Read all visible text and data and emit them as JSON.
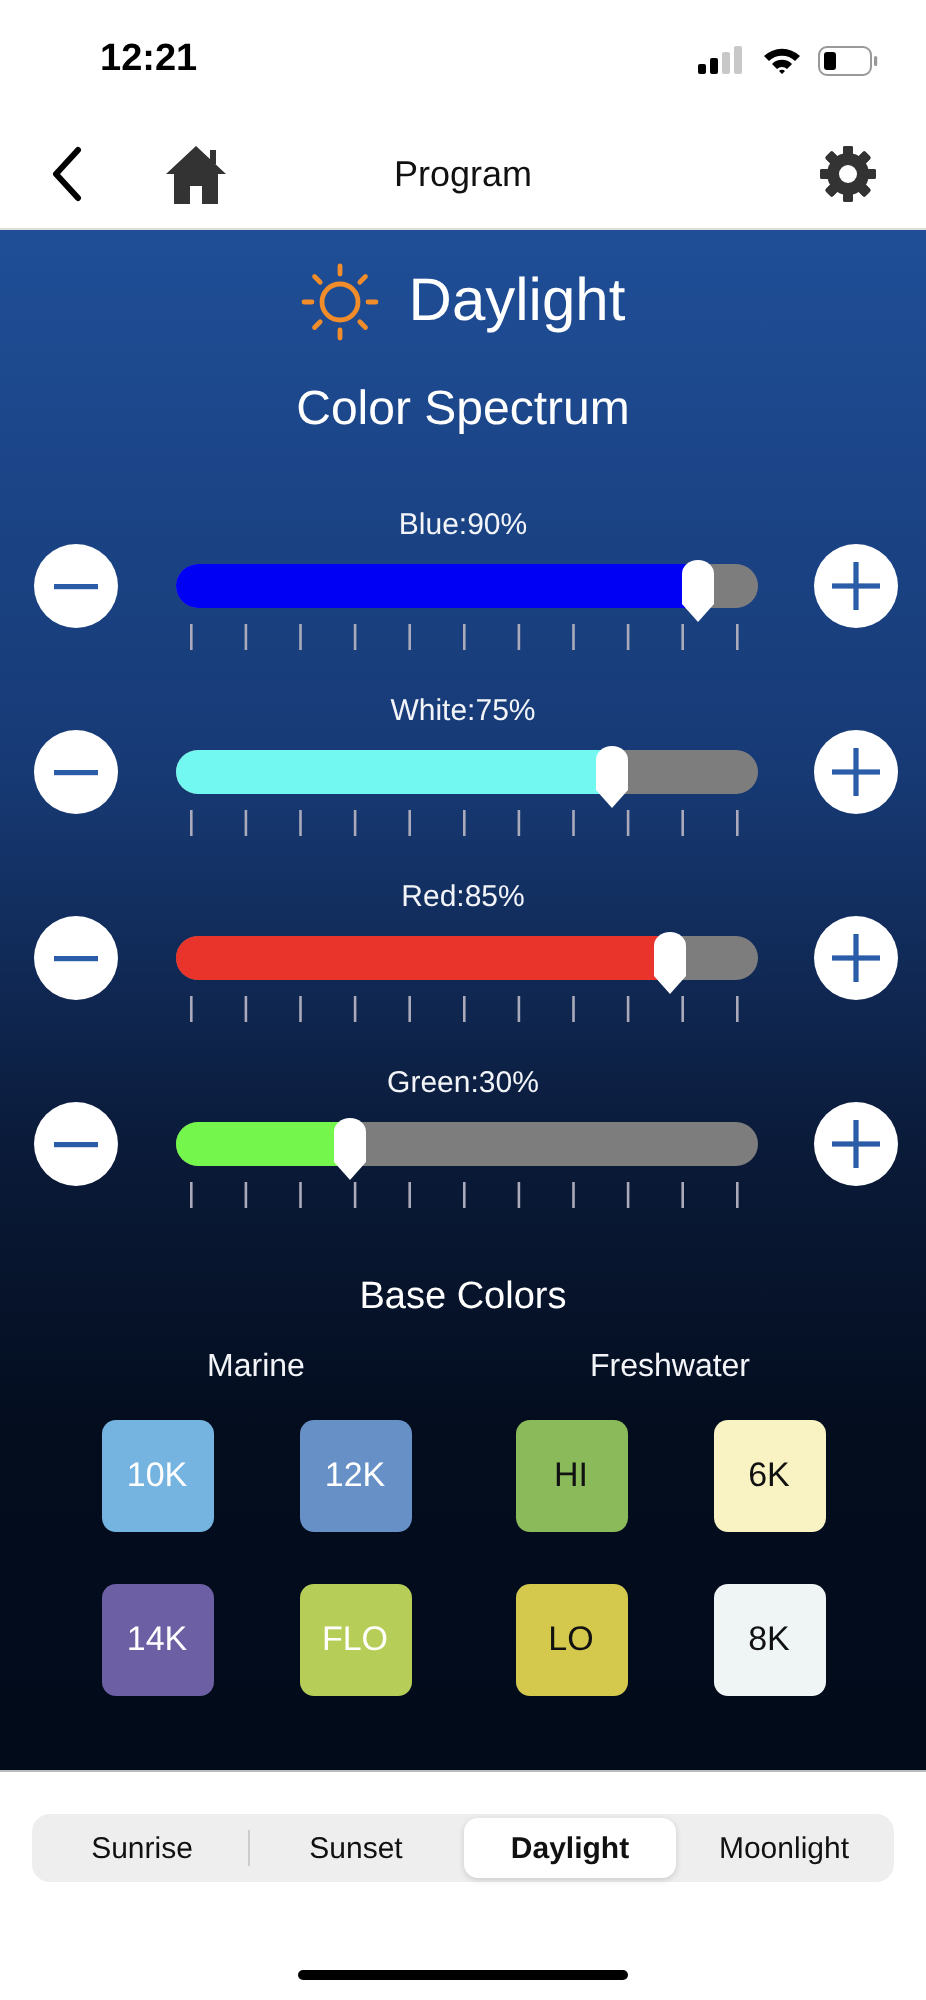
{
  "status_bar": {
    "time": "12:21"
  },
  "nav": {
    "title": "Program"
  },
  "header": {
    "title": "Daylight"
  },
  "spectrum": {
    "title": "Color Spectrum",
    "channels": [
      {
        "label": "Blue:90%",
        "level": 0.9,
        "color": "#0000f5"
      },
      {
        "label": "White:75%",
        "level": 0.75,
        "color": "#72f8f0"
      },
      {
        "label": "Red:85%",
        "level": 0.85,
        "color": "#e8342a"
      },
      {
        "label": "Green:30%",
        "level": 0.3,
        "color": "#74f64c"
      }
    ]
  },
  "base_colors": {
    "title": "Base Colors",
    "groups": [
      {
        "label": "Marine",
        "swatches": [
          {
            "label": "10K",
            "color": "#75b3e0",
            "dark_text": false
          },
          {
            "label": "12K",
            "color": "#6690c6",
            "dark_text": false
          },
          {
            "label": "14K",
            "color": "#6c5fa3",
            "dark_text": false
          },
          {
            "label": "FLO",
            "color": "#b6ce58",
            "dark_text": false
          }
        ]
      },
      {
        "label": "Freshwater",
        "swatches": [
          {
            "label": "HI",
            "color": "#8bba5b",
            "dark_text": true
          },
          {
            "label": "6K",
            "color": "#f9f2c3",
            "dark_text": true
          },
          {
            "label": "LO",
            "color": "#d4c84d",
            "dark_text": true
          },
          {
            "label": "8K",
            "color": "#eff5f5",
            "dark_text": true
          }
        ]
      }
    ]
  },
  "tabs": [
    {
      "label": "Sunrise",
      "selected": false
    },
    {
      "label": "Sunset",
      "selected": false
    },
    {
      "label": "Daylight",
      "selected": true
    },
    {
      "label": "Moonlight",
      "selected": false
    }
  ]
}
